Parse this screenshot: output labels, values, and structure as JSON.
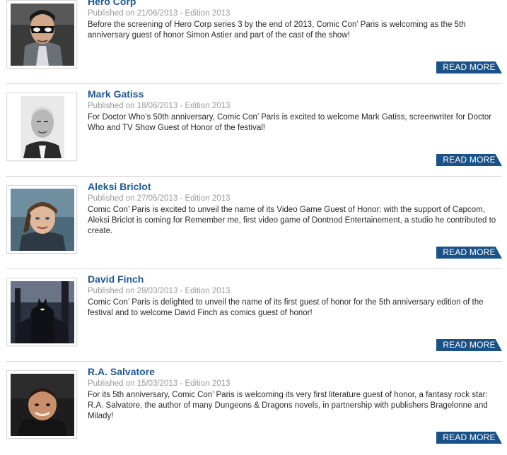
{
  "news": [
    {
      "title": "Hero Corp",
      "meta": "Published on 21/06/2013 - Edition 2013",
      "excerpt": "Before the screening of Hero Corp series 3 by the end of 2013, Comic Con’ Paris is welcoming as the 5th anniversary guest of honor Simon Astier and part of the cast of the show!",
      "button": "READ MORE"
    },
    {
      "title": "Mark Gatiss",
      "meta": "Published on 18/06/2013 - Edition 2013",
      "excerpt": "For Doctor Who’s 50th anniversary, Comic Con’ Paris is excited to welcome Mark Gatiss, screenwriter for Doctor Who and TV Show Guest of Honor of the festival!",
      "button": "READ MORE"
    },
    {
      "title": "Aleksi Briclot",
      "meta": "Published on 27/05/2013 - Edition 2013",
      "excerpt": "Comic Con’ Paris is excited to unveil the name of its Video Game Guest of Honor: with the support of Capcom, Aleksi Briclot is coming for Remember me, first video game of Dontnod Entertainement, a studio he contributed to create.",
      "button": "READ MORE"
    },
    {
      "title": "David Finch",
      "meta": "Published on 28/03/2013 - Edition 2013",
      "excerpt": "Comic Con’ Paris is delighted to unveil the name of its first guest of honor for the 5th anniversary edition of the festival and to welcome David Finch as comics guest of honor!",
      "button": "READ MORE"
    },
    {
      "title": "R.A. Salvatore",
      "meta": "Published on 15/03/2013 - Edition 2013",
      "excerpt": "For its 5th anniversary, Comic Con’ Paris is welcoming its very first literature guest of honor, a fantasy rock star: R.A. Salvatore, the author of many Dungeons & Dragons novels, in partnership with publishers Bragelonne and Milady!",
      "button": "READ MORE"
    }
  ]
}
